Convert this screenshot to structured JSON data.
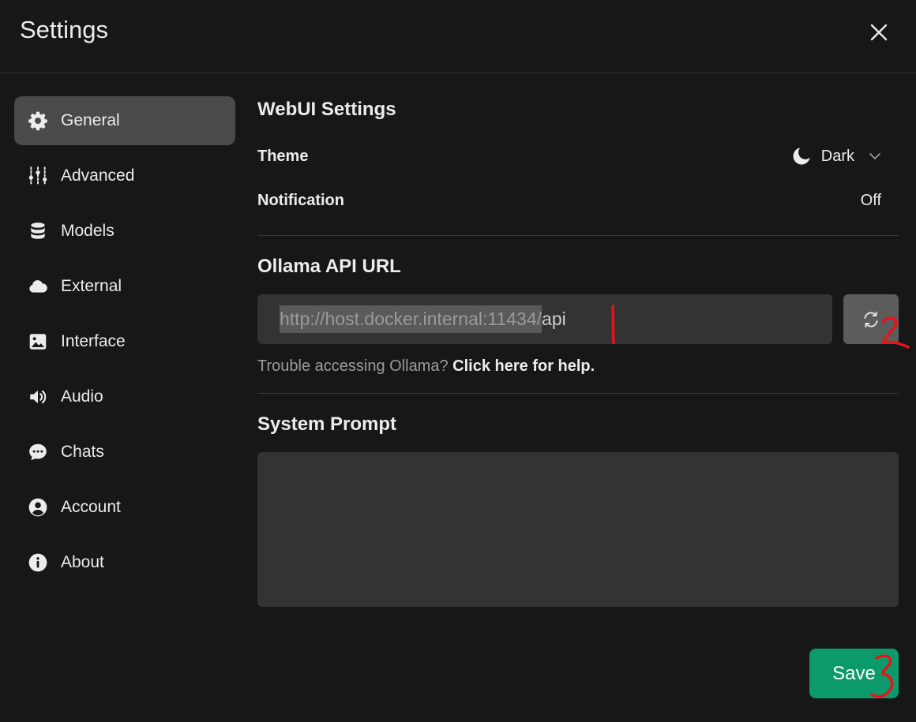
{
  "header": {
    "title": "Settings"
  },
  "sidebar": {
    "items": [
      {
        "label": "General",
        "icon": "gear-icon",
        "active": true
      },
      {
        "label": "Advanced",
        "icon": "sliders-icon",
        "active": false
      },
      {
        "label": "Models",
        "icon": "database-icon",
        "active": false
      },
      {
        "label": "External",
        "icon": "cloud-icon",
        "active": false
      },
      {
        "label": "Interface",
        "icon": "image-icon",
        "active": false
      },
      {
        "label": "Audio",
        "icon": "speaker-icon",
        "active": false
      },
      {
        "label": "Chats",
        "icon": "chat-bubble-icon",
        "active": false
      },
      {
        "label": "Account",
        "icon": "user-circle-icon",
        "active": false
      },
      {
        "label": "About",
        "icon": "info-icon",
        "active": false
      }
    ]
  },
  "webui": {
    "title": "WebUI Settings",
    "theme_label": "Theme",
    "theme_value": "Dark",
    "notification_label": "Notification",
    "notification_value": "Off"
  },
  "ollama": {
    "title": "Ollama API URL",
    "url_selected": "http://host.docker.internal:11434/",
    "url_rest": "api",
    "help_text": "Trouble accessing Ollama?",
    "help_link": "Click here for help."
  },
  "system_prompt": {
    "title": "System Prompt",
    "value": ""
  },
  "footer": {
    "save_label": "Save"
  },
  "annotations": {
    "mark_1": "1",
    "mark_2": "2",
    "mark_3": "3"
  },
  "colors": {
    "background": "#171717",
    "active_item": "#4a4a4a",
    "input_bg": "#333333",
    "save_button": "#0c9a6a",
    "annotation": "#e5141b"
  }
}
